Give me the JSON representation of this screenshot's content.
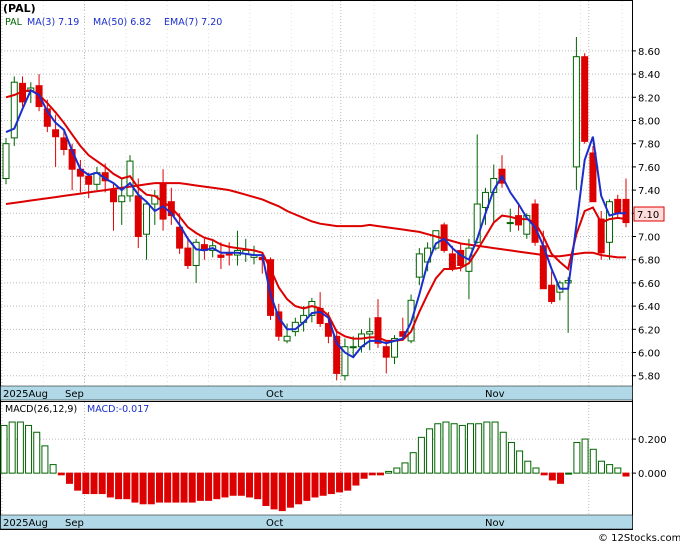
{
  "title": "(PAL)",
  "legend": {
    "ticker": "PAL",
    "ma3": "MA(3)  7.19",
    "ma50": "MA(50)  6.82",
    "ema7": "EMA(7)  7.20"
  },
  "macd_legend": {
    "params": "MACD(26,12,9)",
    "value": "MACD:-0.017"
  },
  "price_tag": "7.10",
  "watermark": "© 12Stocks.com",
  "x_labels": [
    "2025Aug",
    "Sep",
    "Oct",
    "Nov"
  ],
  "colors": {
    "up": "#006400",
    "down": "#dd0000",
    "ma_blue": "#1a2ecc",
    "ma_red": "#dd0000",
    "date_strip": "#b0d8e6",
    "grid": "#bbbbbb"
  },
  "chart_data": [
    {
      "type": "candlestick",
      "title": "(PAL)",
      "y_ticks": [
        "8.60",
        "8.40",
        "8.20",
        "8.00",
        "7.80",
        "7.60",
        "7.40",
        "7.20",
        "7.00",
        "6.80",
        "6.60",
        "6.40",
        "6.20",
        "6.00",
        "5.80"
      ],
      "ylim": [
        5.72,
        8.78
      ],
      "last_price": 7.1,
      "candles": [
        [
          7.5,
          7.85,
          7.45,
          7.8
        ],
        [
          7.85,
          8.38,
          7.78,
          8.33
        ],
        [
          8.32,
          8.38,
          8.12,
          8.16
        ],
        [
          8.25,
          8.33,
          8.15,
          8.28
        ],
        [
          8.3,
          8.4,
          8.08,
          8.12
        ],
        [
          8.1,
          8.18,
          7.9,
          7.95
        ],
        [
          7.92,
          8.05,
          7.6,
          7.86
        ],
        [
          7.85,
          7.92,
          7.7,
          7.75
        ],
        [
          7.75,
          7.8,
          7.4,
          7.58
        ],
        [
          7.58,
          7.66,
          7.38,
          7.52
        ],
        [
          7.52,
          7.55,
          7.33,
          7.45
        ],
        [
          7.45,
          7.6,
          7.4,
          7.55
        ],
        [
          7.55,
          7.63,
          7.38,
          7.48
        ],
        [
          7.4,
          7.46,
          7.05,
          7.3
        ],
        [
          7.3,
          7.5,
          7.1,
          7.35
        ],
        [
          7.35,
          7.7,
          7.3,
          7.65
        ],
        [
          7.35,
          7.5,
          6.9,
          7.0
        ],
        [
          7.02,
          7.3,
          6.8,
          7.28
        ],
        [
          7.28,
          7.4,
          7.1,
          7.35
        ],
        [
          7.45,
          7.58,
          7.05,
          7.15
        ],
        [
          7.3,
          7.42,
          7.1,
          7.18
        ],
        [
          7.08,
          7.2,
          6.85,
          6.9
        ],
        [
          6.9,
          7.0,
          6.72,
          6.75
        ],
        [
          6.75,
          6.98,
          6.6,
          6.95
        ],
        [
          6.93,
          6.98,
          6.8,
          6.88
        ],
        [
          6.88,
          6.98,
          6.82,
          6.92
        ],
        [
          6.84,
          6.95,
          6.72,
          6.82
        ],
        [
          6.85,
          6.95,
          6.75,
          6.84
        ],
        [
          6.84,
          7.05,
          6.75,
          6.88
        ],
        [
          6.85,
          6.98,
          6.78,
          6.88
        ],
        [
          6.82,
          6.92,
          6.76,
          6.84
        ],
        [
          6.82,
          6.85,
          6.68,
          6.8
        ],
        [
          6.8,
          6.82,
          6.28,
          6.32
        ],
        [
          6.35,
          6.42,
          6.1,
          6.14
        ],
        [
          6.1,
          6.25,
          6.08,
          6.14
        ],
        [
          6.18,
          6.3,
          6.14,
          6.26
        ],
        [
          6.26,
          6.4,
          6.18,
          6.32
        ],
        [
          6.32,
          6.47,
          6.26,
          6.44
        ],
        [
          6.38,
          6.52,
          6.22,
          6.25
        ],
        [
          6.25,
          6.35,
          6.08,
          6.14
        ],
        [
          6.14,
          6.2,
          5.76,
          5.82
        ],
        [
          5.8,
          6.12,
          5.76,
          6.05
        ],
        [
          6.05,
          6.14,
          5.96,
          6.05
        ],
        [
          6.05,
          6.2,
          6.0,
          6.16
        ],
        [
          6.16,
          6.3,
          6.02,
          6.18
        ],
        [
          6.3,
          6.46,
          6.04,
          6.08
        ],
        [
          6.05,
          6.1,
          5.82,
          5.96
        ],
        [
          5.96,
          6.15,
          5.9,
          6.12
        ],
        [
          6.18,
          6.3,
          6.1,
          6.14
        ],
        [
          6.1,
          6.5,
          6.08,
          6.45
        ],
        [
          6.65,
          6.9,
          6.58,
          6.85
        ],
        [
          6.78,
          6.95,
          6.7,
          6.9
        ],
        [
          6.9,
          7.05,
          6.88,
          7.05
        ],
        [
          7.1,
          7.12,
          6.86,
          6.88
        ],
        [
          6.85,
          6.92,
          6.7,
          6.72
        ],
        [
          6.88,
          6.94,
          6.7,
          6.75
        ],
        [
          6.7,
          6.98,
          6.46,
          6.9
        ],
        [
          6.95,
          7.88,
          6.94,
          7.28
        ],
        [
          7.25,
          7.42,
          7.1,
          7.38
        ],
        [
          7.38,
          7.62,
          7.12,
          7.5
        ],
        [
          7.58,
          7.7,
          7.42,
          7.46
        ],
        [
          7.12,
          7.24,
          7.04,
          7.12
        ],
        [
          7.18,
          7.28,
          7.05,
          7.1
        ],
        [
          7.02,
          7.2,
          6.98,
          7.18
        ],
        [
          7.28,
          7.32,
          6.92,
          6.95
        ],
        [
          6.92,
          7.05,
          6.55,
          6.55
        ],
        [
          6.58,
          6.7,
          6.42,
          6.44
        ],
        [
          6.52,
          6.62,
          6.45,
          6.6
        ],
        [
          6.6,
          6.65,
          6.17,
          6.62
        ],
        [
          7.6,
          8.72,
          7.4,
          8.55
        ],
        [
          8.55,
          8.58,
          7.8,
          7.82
        ],
        [
          7.72,
          7.78,
          7.3,
          7.3
        ],
        [
          7.15,
          7.22,
          6.8,
          6.86
        ],
        [
          6.95,
          7.32,
          6.8,
          7.3
        ],
        [
          7.32,
          7.36,
          7.15,
          7.2
        ],
        [
          7.32,
          7.5,
          7.08,
          7.12
        ]
      ],
      "ma3": [
        7.9,
        7.93,
        8.1,
        8.26,
        8.22,
        8.08,
        7.98,
        7.92,
        7.74,
        7.58,
        7.53,
        7.55,
        7.5,
        7.46,
        7.4,
        7.46,
        7.36,
        7.3,
        7.22,
        7.26,
        7.2,
        7.1,
        6.98,
        6.89,
        6.88,
        6.9,
        6.86,
        6.86,
        6.86,
        6.85,
        6.84,
        6.84,
        6.5,
        6.3,
        6.2,
        6.2,
        6.26,
        6.34,
        6.35,
        6.3,
        6.08,
        6.0,
        5.96,
        6.05,
        6.1,
        6.1,
        6.08,
        6.1,
        6.12,
        6.26,
        6.5,
        6.77,
        6.94,
        6.98,
        6.9,
        6.84,
        6.8,
        6.98,
        7.2,
        7.4,
        7.52,
        7.38,
        7.28,
        7.16,
        7.08,
        6.92,
        6.72,
        6.55,
        6.55,
        7.1,
        7.66,
        7.86,
        7.35,
        7.18,
        7.2,
        7.2
      ],
      "ema7": [
        8.2,
        8.22,
        8.25,
        8.26,
        8.22,
        8.15,
        8.07,
        7.98,
        7.88,
        7.78,
        7.7,
        7.65,
        7.6,
        7.54,
        7.5,
        7.52,
        7.42,
        7.36,
        7.35,
        7.3,
        7.25,
        7.17,
        7.08,
        7.03,
        6.99,
        6.97,
        6.93,
        6.91,
        6.9,
        6.89,
        6.88,
        6.86,
        6.72,
        6.56,
        6.46,
        6.4,
        6.38,
        6.4,
        6.38,
        6.32,
        6.18,
        6.14,
        6.12,
        6.12,
        6.13,
        6.13,
        6.1,
        6.1,
        6.11,
        6.18,
        6.35,
        6.5,
        6.64,
        6.72,
        6.72,
        6.73,
        6.77,
        6.88,
        7.0,
        7.12,
        7.18,
        7.17,
        7.15,
        7.15,
        7.12,
        7.0,
        6.85,
        6.78,
        6.72,
        7.02,
        7.22,
        7.25,
        7.12,
        7.15,
        7.16,
        7.15
      ],
      "ma50": [
        7.28,
        7.29,
        7.3,
        7.31,
        7.32,
        7.33,
        7.34,
        7.35,
        7.36,
        7.37,
        7.38,
        7.39,
        7.4,
        7.41,
        7.42,
        7.43,
        7.44,
        7.45,
        7.46,
        7.46,
        7.46,
        7.46,
        7.45,
        7.44,
        7.43,
        7.42,
        7.41,
        7.4,
        7.38,
        7.36,
        7.34,
        7.32,
        7.29,
        7.26,
        7.22,
        7.19,
        7.16,
        7.13,
        7.11,
        7.1,
        7.09,
        7.09,
        7.09,
        7.09,
        7.1,
        7.09,
        7.08,
        7.07,
        7.06,
        7.05,
        7.04,
        7.02,
        7.0,
        6.98,
        6.96,
        6.94,
        6.93,
        6.92,
        6.91,
        6.9,
        6.89,
        6.88,
        6.87,
        6.86,
        6.85,
        6.84,
        6.83,
        6.83,
        6.84,
        6.85,
        6.86,
        6.86,
        6.84,
        6.83,
        6.82,
        6.82
      ]
    },
    {
      "type": "bar",
      "title": "MACD(26,12,9)",
      "y_ticks": [
        "0.200",
        "0.000"
      ],
      "ylim": [
        -0.24,
        0.4
      ],
      "values": [
        0.28,
        0.3,
        0.3,
        0.28,
        0.24,
        0.16,
        0.05,
        -0.01,
        -0.06,
        -0.1,
        -0.12,
        -0.12,
        -0.12,
        -0.14,
        -0.15,
        -0.15,
        -0.17,
        -0.18,
        -0.18,
        -0.17,
        -0.17,
        -0.17,
        -0.17,
        -0.17,
        -0.16,
        -0.16,
        -0.15,
        -0.14,
        -0.13,
        -0.13,
        -0.14,
        -0.15,
        -0.19,
        -0.21,
        -0.22,
        -0.2,
        -0.18,
        -0.16,
        -0.14,
        -0.13,
        -0.12,
        -0.11,
        -0.1,
        -0.07,
        -0.03,
        -0.01,
        -0.01,
        0.01,
        0.03,
        0.06,
        0.12,
        0.21,
        0.26,
        0.29,
        0.3,
        0.29,
        0.28,
        0.29,
        0.29,
        0.3,
        0.3,
        0.24,
        0.18,
        0.13,
        0.07,
        0.03,
        -0.01,
        -0.04,
        -0.06,
        0.0,
        0.18,
        0.2,
        0.14,
        0.07,
        0.05,
        0.03,
        -0.017
      ]
    }
  ]
}
